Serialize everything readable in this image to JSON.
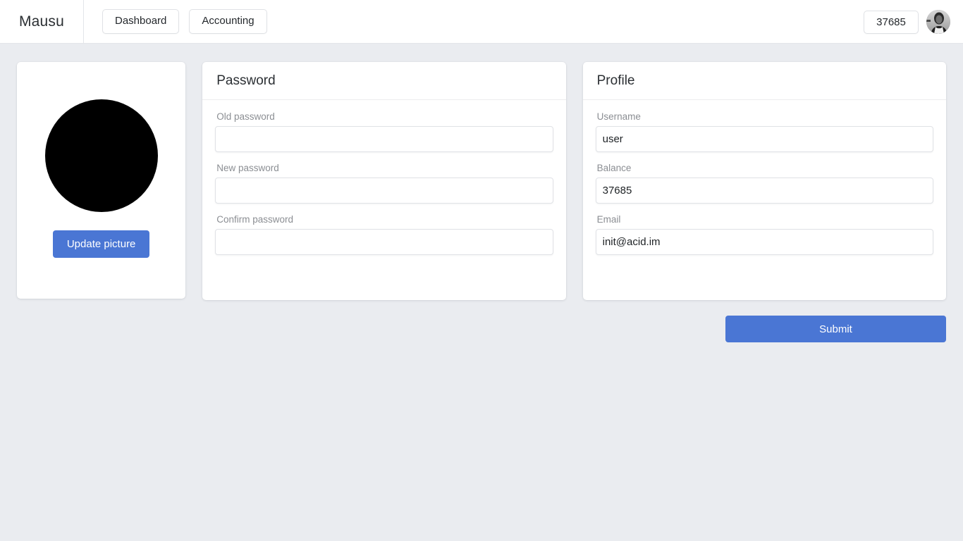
{
  "header": {
    "brand": "Mausu",
    "nav": [
      {
        "label": "Dashboard",
        "name": "nav-dashboard"
      },
      {
        "label": "Accounting",
        "name": "nav-accounting"
      }
    ],
    "balance_badge": "37685",
    "avatar_icon": "user-avatar-photo"
  },
  "picture_card": {
    "avatar_icon": "profile-picture-placeholder",
    "update_button": "Update picture"
  },
  "password_card": {
    "title": "Password",
    "fields": [
      {
        "label": "Old password",
        "value": "",
        "placeholder": ""
      },
      {
        "label": "New password",
        "value": "",
        "placeholder": ""
      },
      {
        "label": "Confirm password",
        "value": "",
        "placeholder": ""
      }
    ]
  },
  "profile_card": {
    "title": "Profile",
    "fields": [
      {
        "label": "Username",
        "value": "user",
        "placeholder": ""
      },
      {
        "label": "Balance",
        "value": "37685",
        "placeholder": ""
      },
      {
        "label": "Email",
        "value": "init@acid.im",
        "placeholder": ""
      }
    ]
  },
  "actions": {
    "submit_label": "Submit"
  },
  "colors": {
    "accent": "#4a76d4",
    "page_background": "#eaecf0",
    "card_background": "#ffffff",
    "label_text": "#8b8e93",
    "body_text": "#1d2124"
  }
}
